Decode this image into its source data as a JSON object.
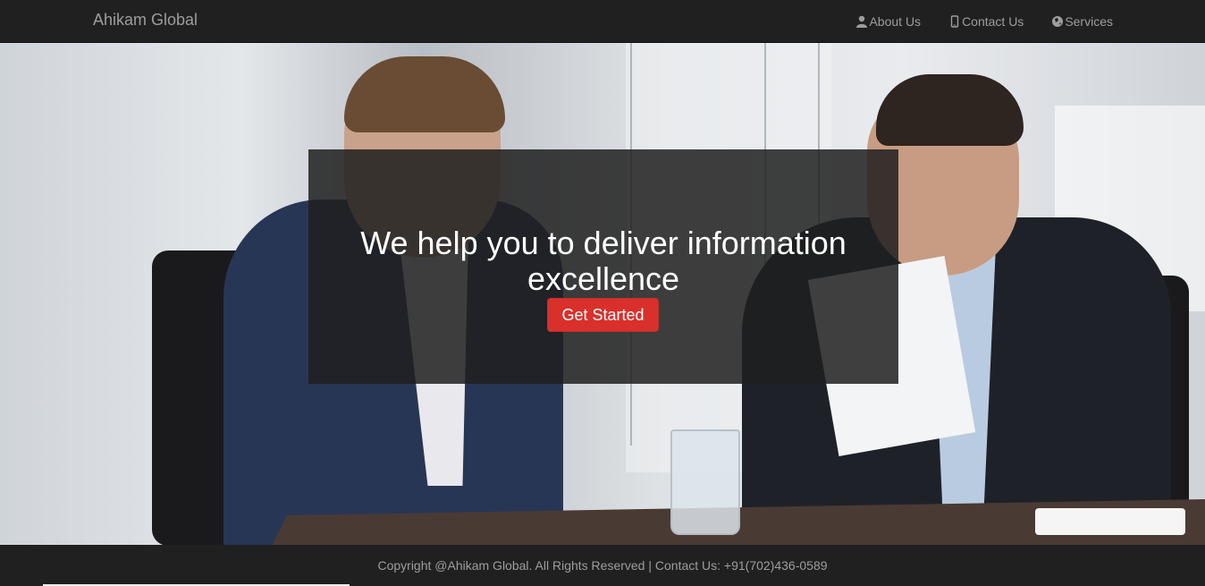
{
  "navbar": {
    "brand": "Ahikam Global",
    "links": [
      {
        "label": "About Us",
        "icon": "user-icon"
      },
      {
        "label": "Contact Us",
        "icon": "phone-icon"
      },
      {
        "label": "Services",
        "icon": "globe-icon"
      }
    ]
  },
  "hero": {
    "title": "We help you to deliver information excellence",
    "cta_label": "Get Started"
  },
  "footer": {
    "text": "Copyright @Ahikam Global. All Rights Reserved | Contact Us: +91(702)436-0589"
  },
  "colors": {
    "navbar_bg": "#202020",
    "nav_text": "#9d9d9d",
    "cta": "#d9302b",
    "overlay": "rgba(30,30,30,0.85)"
  }
}
